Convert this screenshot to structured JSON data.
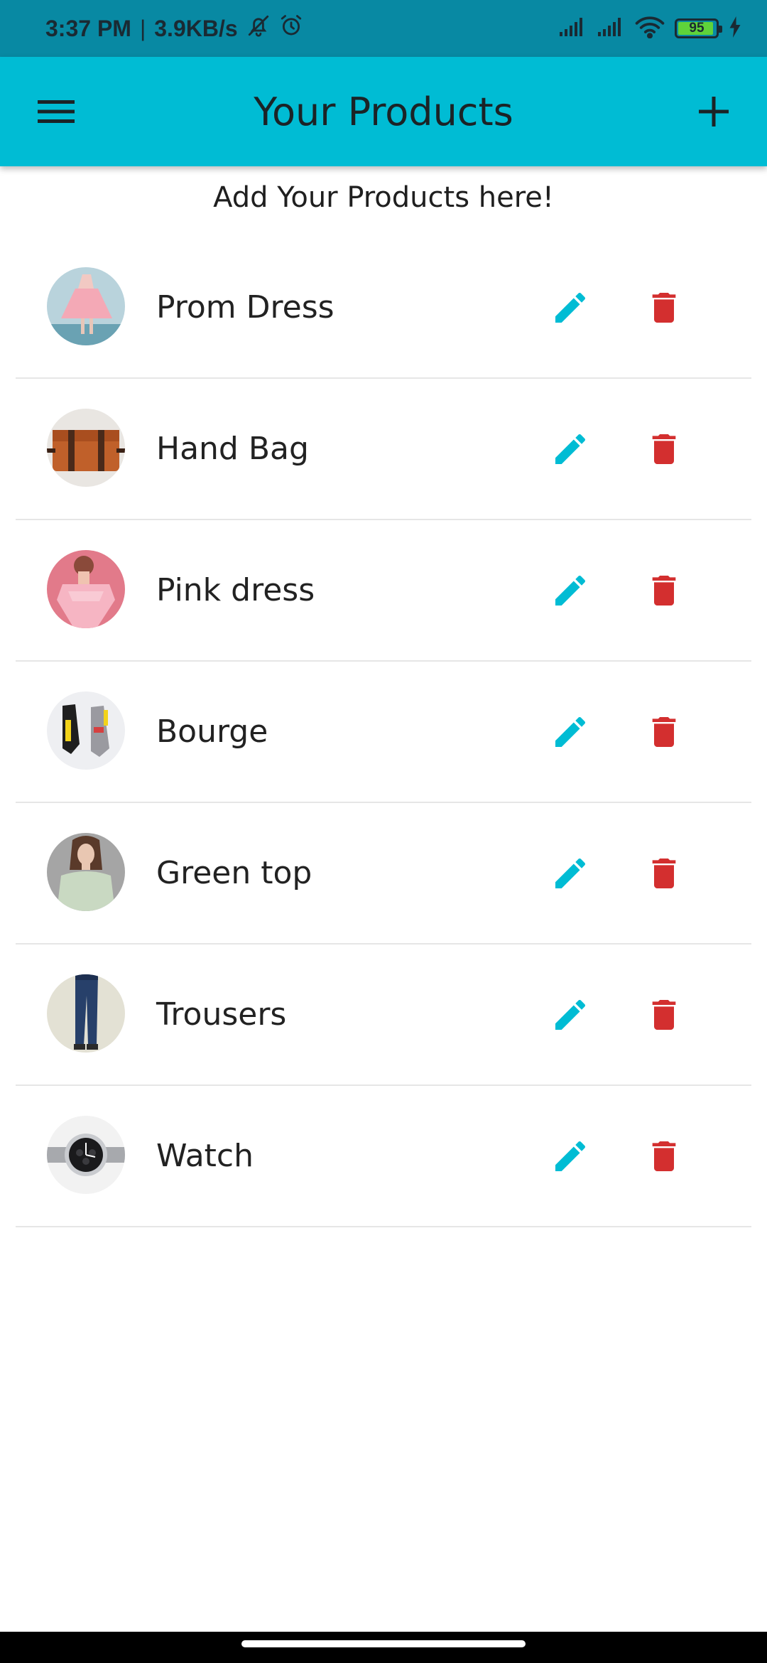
{
  "status_bar": {
    "time": "3:37 PM",
    "separator": "|",
    "speed": "3.9KB/s",
    "battery": "95",
    "battery_level_percent": 95,
    "icons": [
      "bell-off-icon",
      "alarm-icon",
      "signal-icon",
      "signal-icon",
      "wifi-icon",
      "battery-icon",
      "charging-icon"
    ]
  },
  "app_bar": {
    "title": "Your Products",
    "menu_icon": "menu-icon",
    "add_icon": "plus-icon",
    "background": "#00bcd4"
  },
  "subtitle": "Add Your Products here!",
  "colors": {
    "edit": "#00bcd4",
    "delete": "#d32f2f",
    "status_bar": "#0889a3"
  },
  "products": [
    {
      "name": "Prom Dress",
      "image": "pink-dress-photo"
    },
    {
      "name": "Hand Bag",
      "image": "leather-bag-photo"
    },
    {
      "name": "Pink dress",
      "image": "pink-top-photo"
    },
    {
      "name": "Bourge",
      "image": "sneakers-photo"
    },
    {
      "name": "Green top",
      "image": "green-top-photo"
    },
    {
      "name": "Trousers",
      "image": "jeans-photo"
    },
    {
      "name": "Watch",
      "image": "wristwatch-photo"
    }
  ]
}
